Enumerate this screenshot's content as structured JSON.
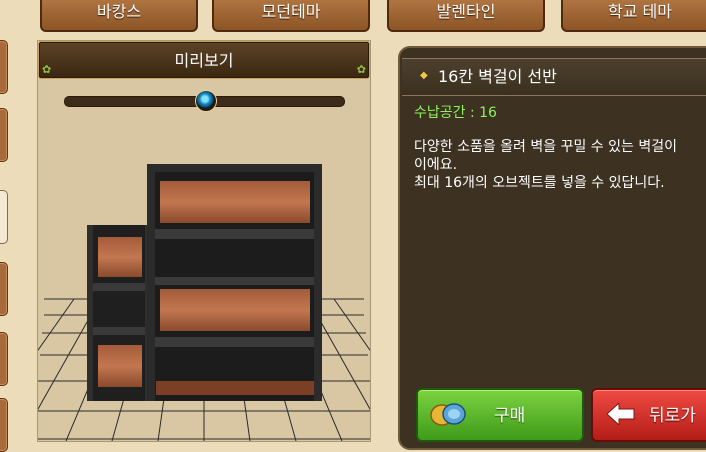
{
  "tabs": [
    {
      "label": "바캉스"
    },
    {
      "label": "모던테마"
    },
    {
      "label": "발렌타인"
    },
    {
      "label": "학교 테마"
    }
  ],
  "preview": {
    "title": "미리보기",
    "zoom_fraction": 0.5
  },
  "item": {
    "name": "16칸 벽걸이 선반",
    "storage_label": "수납공간 : 16",
    "description": "다양한 소품을 올려 벽을 꾸밀 수 있는 벽걸이\n이에요.\n최대 16개의 오브젝트를 넣을 수 있답니다."
  },
  "buttons": {
    "buy": "구매",
    "back": "뒤로가"
  },
  "icons": {
    "buy": "coin-icon",
    "back": "left-arrow-icon",
    "preview_ornament": "leaf-icon",
    "title_bullet": "diamond-bullet-icon"
  },
  "colors": {
    "tab_brown": "#a06534",
    "buy_green": "#5cb82a",
    "back_red": "#d8322b",
    "storage_green": "#8cf55a"
  }
}
